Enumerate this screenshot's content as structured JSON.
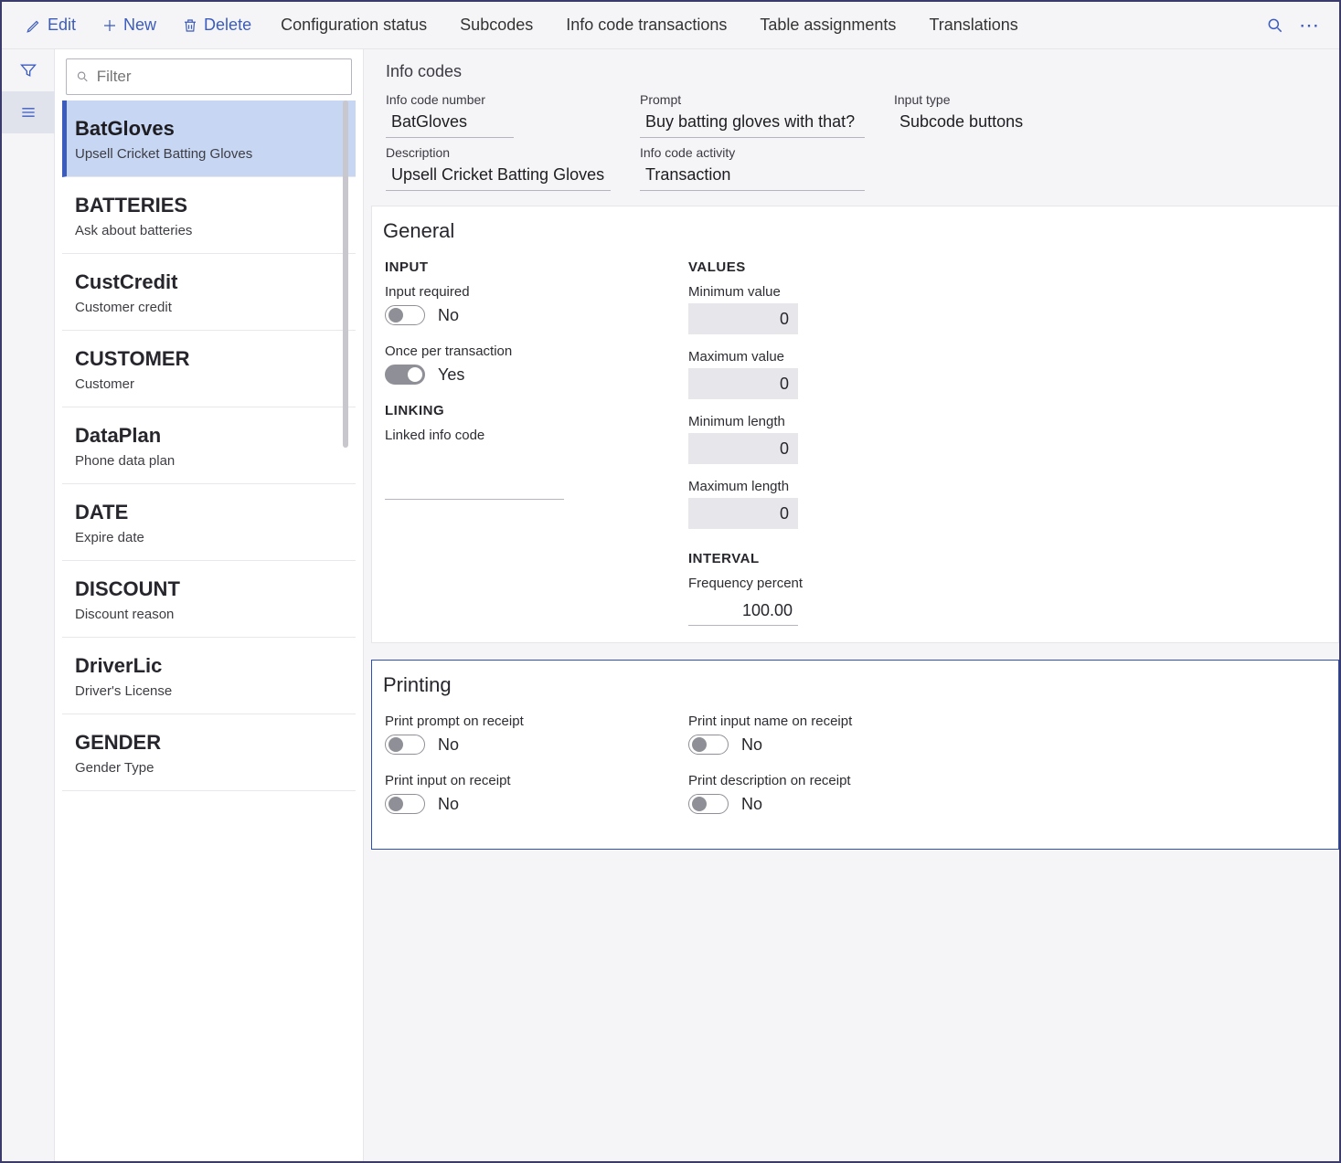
{
  "actions": {
    "edit": "Edit",
    "new": "New",
    "delete": "Delete",
    "config_status": "Configuration status",
    "subcodes": "Subcodes",
    "info_code_tx": "Info code transactions",
    "table_assign": "Table assignments",
    "translations": "Translations"
  },
  "filter": {
    "placeholder": "Filter"
  },
  "list": {
    "items": [
      {
        "title": "BatGloves",
        "sub": "Upsell Cricket Batting Gloves",
        "selected": true
      },
      {
        "title": "BATTERIES",
        "sub": "Ask about batteries"
      },
      {
        "title": "CustCredit",
        "sub": "Customer credit"
      },
      {
        "title": "CUSTOMER",
        "sub": "Customer"
      },
      {
        "title": "DataPlan",
        "sub": "Phone data plan"
      },
      {
        "title": "DATE",
        "sub": "Expire date"
      },
      {
        "title": "DISCOUNT",
        "sub": "Discount reason"
      },
      {
        "title": "DriverLic",
        "sub": "Driver's License"
      },
      {
        "title": "GENDER",
        "sub": "Gender Type"
      }
    ]
  },
  "summary": {
    "title": "Info codes",
    "labels": {
      "info_code_number": "Info code number",
      "prompt": "Prompt",
      "input_type": "Input type",
      "description": "Description",
      "activity": "Info code activity"
    },
    "values": {
      "info_code_number": "BatGloves",
      "prompt": "Buy batting gloves with that?",
      "input_type": "Subcode buttons",
      "description": "Upsell Cricket Batting Gloves",
      "activity": "Transaction"
    }
  },
  "general": {
    "title": "General",
    "headers": {
      "input": "INPUT",
      "values": "VALUES",
      "linking": "LINKING",
      "interval": "INTERVAL"
    },
    "input_required": {
      "label": "Input required",
      "state": "No"
    },
    "once_per_tx": {
      "label": "Once per transaction",
      "state": "Yes"
    },
    "linked_label": "Linked info code",
    "min_value": {
      "label": "Minimum value",
      "val": "0"
    },
    "max_value": {
      "label": "Maximum value",
      "val": "0"
    },
    "min_length": {
      "label": "Minimum length",
      "val": "0"
    },
    "max_length": {
      "label": "Maximum length",
      "val": "0"
    },
    "frequency": {
      "label": "Frequency percent",
      "val": "100.00"
    }
  },
  "printing": {
    "title": "Printing",
    "print_prompt": {
      "label": "Print prompt on receipt",
      "state": "No"
    },
    "print_input": {
      "label": "Print input on receipt",
      "state": "No"
    },
    "print_input_name": {
      "label": "Print input name on receipt",
      "state": "No"
    },
    "print_desc": {
      "label": "Print description on receipt",
      "state": "No"
    }
  }
}
